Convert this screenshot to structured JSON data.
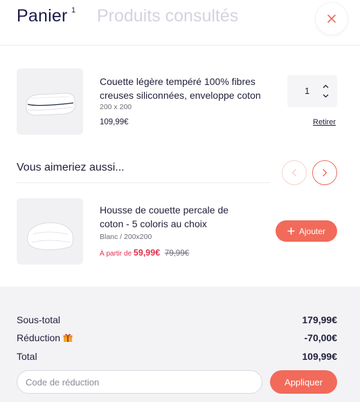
{
  "header": {
    "cart_tab": "Panier",
    "cart_count": "1",
    "viewed_tab": "Produits consultés",
    "close_icon": "close-icon"
  },
  "cart_item": {
    "title": "Couette légère tempéré 100% fibres creuses siliconnées, enveloppe coton",
    "variant": "200 x 200",
    "price": "109,99€",
    "quantity": "1",
    "remove_label": "Retirer"
  },
  "recommendations": {
    "title": "Vous aimeriez aussi...",
    "items": [
      {
        "title": "Housse de couette percale de coton - 5 coloris au choix",
        "variant": "Blanc / 200x200",
        "price_prefix": "À partir de",
        "price": "59,99€",
        "old_price": "79,99€",
        "add_label": "Ajouter"
      }
    ]
  },
  "summary": {
    "subtotal_label": "Sous-total",
    "subtotal_value": "179,99€",
    "discount_label": "Réduction",
    "discount_value": "-70,00€",
    "total_label": "Total",
    "total_value": "109,99€",
    "code_placeholder": "Code de réduction",
    "apply_label": "Appliquer"
  },
  "colors": {
    "accent": "#f26a5a",
    "sale_price": "#e0304e",
    "heading": "#1c1a4a",
    "inactive_tab": "#d4d3de",
    "summary_bg": "#f3f3f6"
  }
}
